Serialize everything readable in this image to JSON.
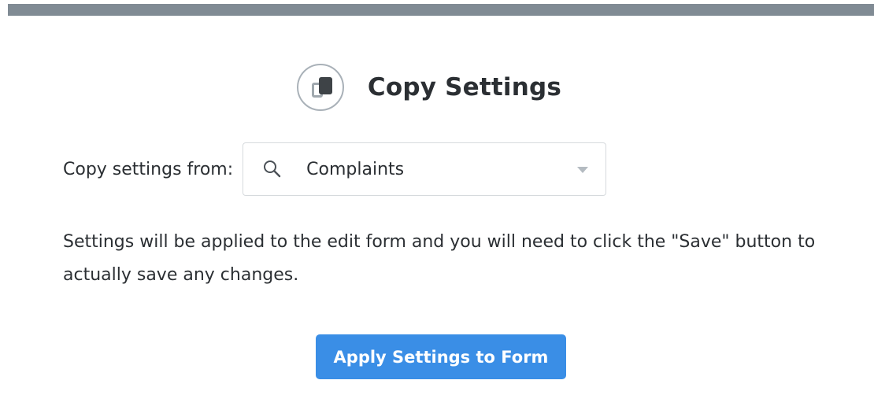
{
  "colors": {
    "top_bar": "#808b94",
    "primary_button": "#3a8ee6",
    "text": "#2b2f33"
  },
  "header": {
    "icon": "copy-icon",
    "title": "Copy Settings"
  },
  "copy_from": {
    "label": "Copy settings from:",
    "search_icon": "search-icon",
    "selected_value": "Complaints",
    "dropdown_icon": "caret-down-icon"
  },
  "info": {
    "message": "Settings will be applied to the edit form and you will need to click the \"Save\" button to actually save any changes."
  },
  "actions": {
    "apply_label": "Apply Settings to Form"
  }
}
